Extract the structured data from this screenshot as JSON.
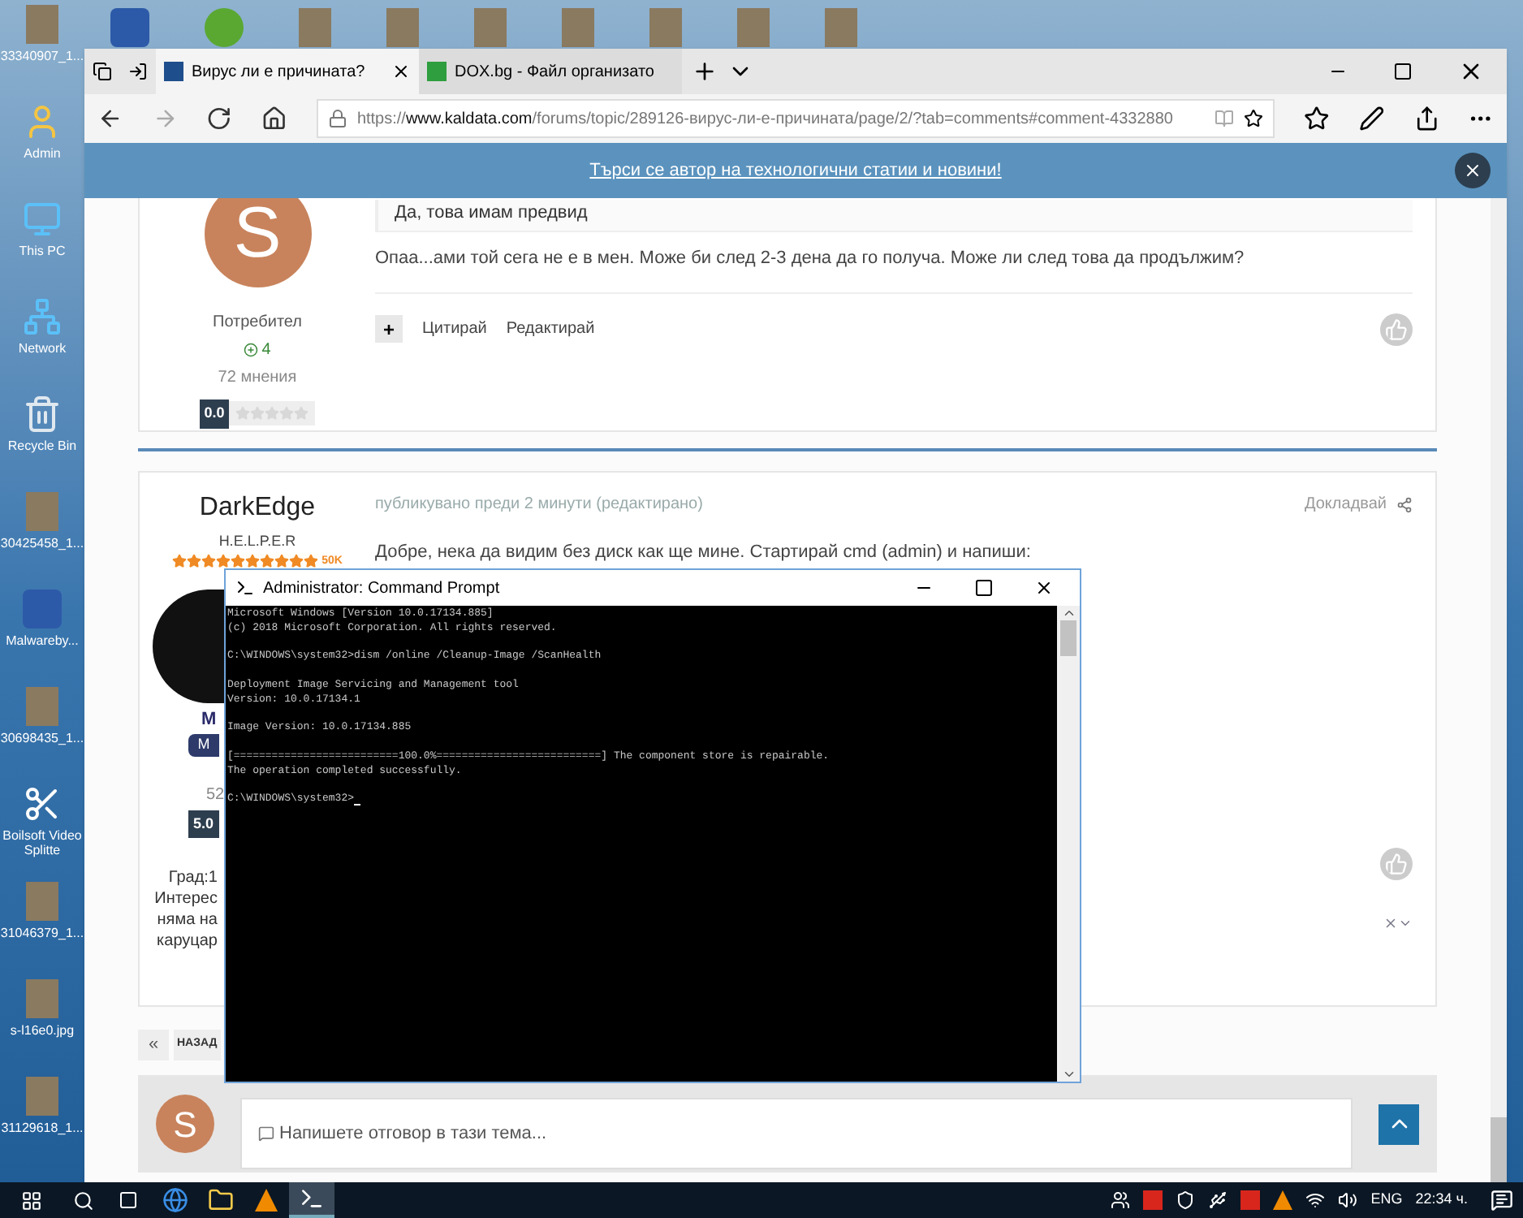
{
  "desktop_icons": [
    {
      "label": "33340907_1...",
      "kind": "photo"
    },
    {
      "label": "Admin",
      "kind": "user"
    },
    {
      "label": "This PC",
      "kind": "pc"
    },
    {
      "label": "Network",
      "kind": "network"
    },
    {
      "label": "Recycle Bin",
      "kind": "bin"
    },
    {
      "label": "30425458_1...",
      "kind": "photo"
    },
    {
      "label": "Malwareby...",
      "kind": "app"
    },
    {
      "label": "30698435_1...",
      "kind": "photo"
    },
    {
      "label": "Boilsoft Video Splitte",
      "kind": "scissors"
    },
    {
      "label": "31046379_1...",
      "kind": "photo"
    },
    {
      "label": "s-l16e0.jpg",
      "kind": "photo"
    },
    {
      "label": "31129618_1...",
      "kind": "photo"
    }
  ],
  "top_icons": [
    {
      "kind": "app"
    },
    {
      "kind": "torrent"
    },
    {
      "kind": "photo"
    },
    {
      "kind": "photo"
    },
    {
      "kind": "photo"
    },
    {
      "kind": "photo"
    },
    {
      "kind": "photo"
    },
    {
      "kind": "photo"
    },
    {
      "kind": "photo"
    }
  ],
  "browser": {
    "tabs": [
      {
        "title": "Вирус ли е причината?",
        "selected": true,
        "color": "#1f4e8c"
      },
      {
        "title": "DOX.bg - Файл организато",
        "selected": false,
        "color": "#2e9e3e"
      }
    ],
    "url_prefix": "https://",
    "url_domain": "www.kaldata.com",
    "url_path": "/forums/topic/289126-вирус-ли-е-причината/page/2/?tab=comments#comment-4332880",
    "banner": "Търси се автор на технологични статии и новини!"
  },
  "post1": {
    "quote": "Да, това имам предвид",
    "text": "Опаа...ами той сега не е в мен. Може би след 2-3 дена да го получа. Може ли след това да продължим?",
    "actions": [
      "Цитирай",
      "Редактирай"
    ],
    "plus": "+",
    "avatar_letter": "S",
    "role": "Потребител",
    "reputation": "4",
    "posts": "72 мнения",
    "rating": "0.0",
    "stars": 0
  },
  "post2": {
    "author": "DarkEdge",
    "rank": "H.E.L.P.E.R",
    "stars": 10,
    "rank_points": "50K",
    "meta": "публикувано преди 2 минути (редактирано)",
    "report": "Докладвай",
    "text": "Добре, нека да видим без диск как ще мине. Стартирай cmd (admin) и напиши:",
    "name_fragment": "M",
    "button_fragment": "M",
    "count_fragment": "52",
    "rating": "5.0",
    "info_fragments": [
      "Град:1",
      "Интерес",
      "няма на",
      "каруцар"
    ]
  },
  "pagination": {
    "first": "«",
    "prev": "НАЗАД"
  },
  "reply": {
    "avatar_letter": "S",
    "placeholder": "Напишете отговор в тази тема..."
  },
  "cmd": {
    "title": "Administrator: Command Prompt",
    "blocks": [
      [
        "Microsoft Windows [Version 10.0.17134.885]",
        "(c) 2018 Microsoft Corporation. All rights reserved."
      ],
      [
        "C:\\WINDOWS\\system32>dism /online /Cleanup-Image /ScanHealth"
      ],
      [
        "Deployment Image Servicing and Management tool",
        "Version: 10.0.17134.1"
      ],
      [
        "Image Version: 10.0.17134.885"
      ],
      [
        "[==========================100.0%==========================] The component store is repairable.",
        "The operation completed successfully."
      ],
      [
        "C:\\WINDOWS\\system32>"
      ]
    ]
  },
  "taskbar": {
    "apps": [
      {
        "kind": "edge",
        "selected": false
      },
      {
        "kind": "folder",
        "selected": false
      },
      {
        "kind": "vlc",
        "selected": false
      },
      {
        "kind": "cmd",
        "selected": true
      }
    ],
    "language": "ENG",
    "time": "22:34 ч."
  }
}
